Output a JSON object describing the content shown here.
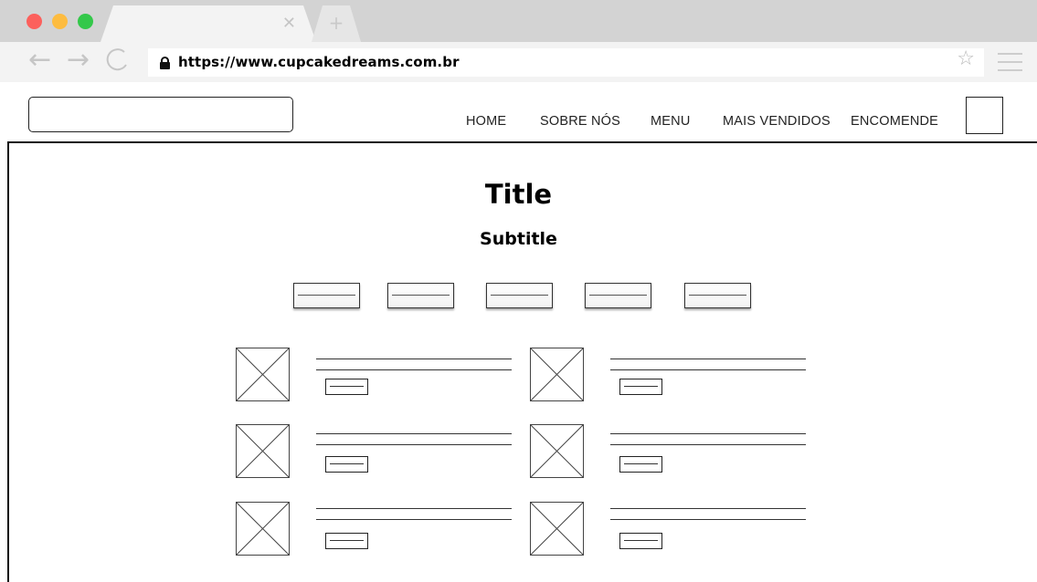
{
  "browser": {
    "url": "https://www.cupcakedreams.com.br",
    "icons": {
      "tab_close": "close-icon",
      "new_tab": "plus-icon",
      "back": "arrow-left-icon",
      "forward": "arrow-right-icon",
      "reload": "reload-icon",
      "secure": "lock-icon",
      "bookmark": "star-icon",
      "menu": "hamburger-menu-icon"
    },
    "colors": {
      "close": "#fc605c",
      "minimize": "#fdbc40",
      "zoom": "#34c84a"
    }
  },
  "header": {
    "nav": [
      {
        "label": "HOME"
      },
      {
        "label": "SOBRE NÓS"
      },
      {
        "label": "MENU"
      },
      {
        "label": "MAIS VENDIDOS"
      },
      {
        "label": "ENCOMENDE"
      }
    ]
  },
  "main": {
    "title": "Title",
    "subtitle": "Subtitle"
  }
}
